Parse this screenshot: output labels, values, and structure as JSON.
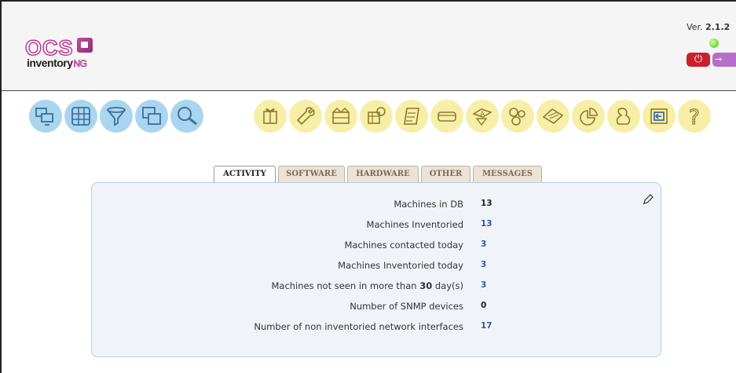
{
  "header": {
    "logo": {
      "brand": "OCS",
      "product": "inventory",
      "suffix": "NG"
    },
    "version_prefix": "Ver. ",
    "version_number": "2.1.2",
    "logout_icon": "power-icon",
    "admin_icon": "key-icon",
    "status_color": "#52c41a"
  },
  "menu": {
    "left": [
      {
        "icon": "computers-icon",
        "color": "#a9d6ee"
      },
      {
        "icon": "groups-icon",
        "color": "#a9d6ee"
      },
      {
        "icon": "filter-icon",
        "color": "#a9d6ee"
      },
      {
        "icon": "duplicates-icon",
        "color": "#a9d6ee"
      },
      {
        "icon": "search-icon",
        "color": "#a9d6ee"
      }
    ],
    "right": [
      {
        "icon": "packages-icon",
        "color": "#f7efa8"
      },
      {
        "icon": "configuration-icon",
        "color": "#f7efa8"
      },
      {
        "icon": "network-icon",
        "color": "#f7efa8"
      },
      {
        "icon": "registry-icon",
        "color": "#f7efa8"
      },
      {
        "icon": "logs-icon",
        "color": "#f7efa8"
      },
      {
        "icon": "snmp-icon",
        "color": "#f7efa8"
      },
      {
        "icon": "software-dictionary-icon",
        "color": "#f7efa8"
      },
      {
        "icon": "plugins-icon",
        "color": "#f7efa8"
      },
      {
        "icon": "reports-icon",
        "color": "#f7efa8"
      },
      {
        "icon": "statistics-icon",
        "color": "#f7efa8"
      },
      {
        "icon": "users-icon",
        "color": "#f7efa8"
      },
      {
        "icon": "back-icon",
        "color": "#f7efa8"
      },
      {
        "icon": "help-icon",
        "color": "#f7efa8"
      }
    ]
  },
  "tabs": [
    {
      "label": "ACTIVITY",
      "active": true
    },
    {
      "label": "SOFTWARE",
      "active": false
    },
    {
      "label": "HARDWARE",
      "active": false
    },
    {
      "label": "OTHER",
      "active": false
    },
    {
      "label": "MESSAGES",
      "active": false
    }
  ],
  "activity": {
    "edit_icon": "pencil-icon",
    "rows": [
      {
        "label": "Machines in DB",
        "value": "13",
        "link": false
      },
      {
        "label": "Machines Inventoried",
        "value": "13",
        "link": true
      },
      {
        "label": "Machines contacted today",
        "value": "3",
        "link": true
      },
      {
        "label": "Machines Inventoried today",
        "value": "3",
        "link": true
      },
      {
        "label_pre": "Machines not seen in more than ",
        "label_num": "30",
        "label_post": " day(s)",
        "value": "3",
        "link": true
      },
      {
        "label": "Number of SNMP devices",
        "value": "0",
        "link": false
      },
      {
        "label": "Number of non inventoried network interfaces",
        "value": "17",
        "link": true
      }
    ]
  }
}
